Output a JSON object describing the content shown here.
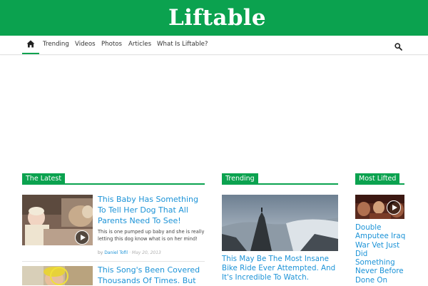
{
  "header": {
    "logo_text": "Liftable",
    "brand_color": "#0ba24f"
  },
  "nav": {
    "home_icon": "home-icon",
    "items": [
      "Trending",
      "Videos",
      "Photos",
      "Articles",
      "What Is Liftable?"
    ],
    "search_icon": "search-icon"
  },
  "latest": {
    "section_title": "The Latest",
    "articles": [
      {
        "title": "This Baby Has Something To Tell Her Dog That All Parents Need To See!",
        "excerpt": "This is one pumped up baby and she is really letting this dog know what is on her mind!",
        "author_prefix": "by",
        "author": "Daniel Tofil",
        "date_separator": "·",
        "date": "May 20, 2013",
        "has_video": true
      },
      {
        "title": "This Song's Been Covered Thousands Of Times. But",
        "has_video": false
      }
    ]
  },
  "trending": {
    "section_title": "Trending",
    "articles": [
      {
        "title": "This May Be The Most Insane Bike Ride Ever Attempted. And It's Incredible To Watch."
      }
    ]
  },
  "most_lifted": {
    "section_title": "Most Lifted",
    "articles": [
      {
        "title": "Double Amputee Iraq War Vet Just Did Something Never Before Done On",
        "has_video": true
      }
    ]
  }
}
